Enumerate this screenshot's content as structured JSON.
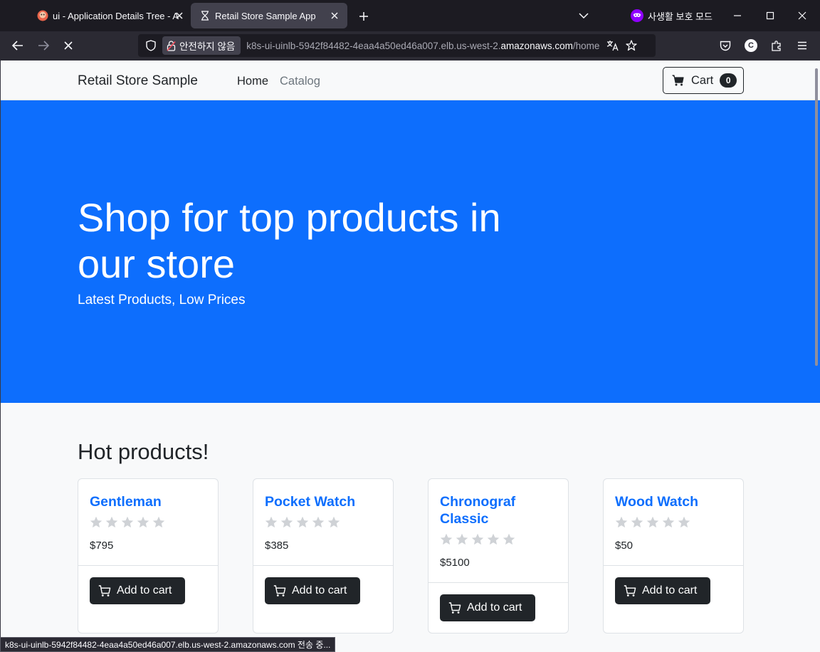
{
  "browser": {
    "tabs": [
      {
        "title": "ui - Application Details Tree - A",
        "active": false
      },
      {
        "title": "Retail Store Sample App",
        "active": true
      }
    ],
    "private_label": "사생활 보호 모드",
    "insecure_label": "안전하지 않음",
    "url_prefix": "k8s-ui-uinlb-5942f84482-4eaa4a50ed46a007.elb.us-west-2.",
    "url_domain": "amazonaws.com",
    "url_suffix": "/home",
    "profile_initial": "C",
    "status_text": "k8s-ui-uinlb-5942f84482-4eaa4a50ed46a007.elb.us-west-2.amazonaws.com 전송 중..."
  },
  "site": {
    "brand": "Retail Store Sample",
    "nav": {
      "home": "Home",
      "catalog": "Catalog"
    },
    "cart": {
      "label": "Cart",
      "count": "0"
    },
    "hero": {
      "title": "Shop for top products in our store",
      "subtitle": "Latest Products, Low Prices"
    },
    "hot_title": "Hot products!",
    "products": [
      {
        "name": "Gentleman",
        "price": "$795",
        "rating": 0,
        "button": "Add to cart"
      },
      {
        "name": "Pocket Watch",
        "price": "$385",
        "rating": 0,
        "button": "Add to cart"
      },
      {
        "name": "Chronograf Classic",
        "price": "$5100",
        "rating": 0,
        "button": "Add to cart"
      },
      {
        "name": "Wood Watch",
        "price": "$50",
        "rating": 0,
        "button": "Add to cart"
      }
    ]
  },
  "colors": {
    "primary": "#0d6efd",
    "dark": "#212529",
    "star_empty": "#cfd2d6",
    "browser_bg": "#1c1b22"
  }
}
